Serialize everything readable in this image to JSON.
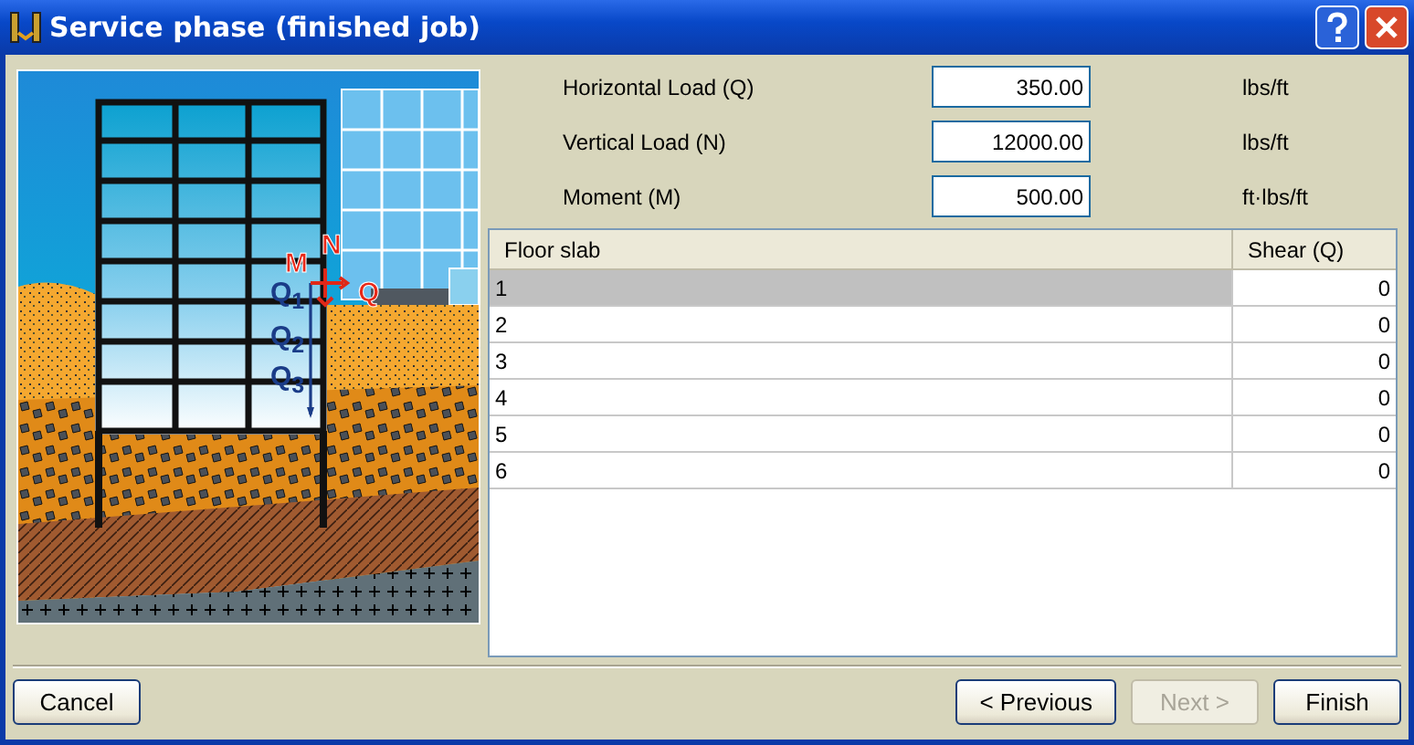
{
  "window": {
    "title": "Service phase (finished job)"
  },
  "diagram": {
    "labels": [
      {
        "text": "M",
        "kind": "load"
      },
      {
        "text": "N",
        "kind": "load"
      },
      {
        "text": "Q",
        "kind": "load"
      },
      {
        "text": "Q$_{1}$",
        "kind": "shear"
      },
      {
        "text": "Q$_{2}$",
        "kind": "shear"
      },
      {
        "text": "Q$_{3}$",
        "kind": "shear"
      }
    ]
  },
  "fields": [
    {
      "label": "Horizontal Load (Q)",
      "value": "350.00",
      "unit": "lbs/ft"
    },
    {
      "label": "Vertical Load (N)",
      "value": "12000.00",
      "unit": "lbs/ft"
    },
    {
      "label": "Moment (M)",
      "value": "500.00",
      "unit": "ft·lbs/ft"
    }
  ],
  "table": {
    "columns": [
      "Floor slab",
      "Shear (Q)"
    ],
    "rows": [
      {
        "cells": [
          "1",
          "0"
        ],
        "selected": true
      },
      {
        "cells": [
          "2",
          "0"
        ],
        "selected": false
      },
      {
        "cells": [
          "3",
          "0"
        ],
        "selected": false
      },
      {
        "cells": [
          "4",
          "0"
        ],
        "selected": false
      },
      {
        "cells": [
          "5",
          "0"
        ],
        "selected": false
      },
      {
        "cells": [
          "6",
          "0"
        ],
        "selected": false
      }
    ]
  },
  "buttons": [
    {
      "label": "Cancel",
      "disabled": false,
      "kind": "left"
    },
    {
      "label": "< Previous",
      "disabled": false,
      "kind": "right"
    },
    {
      "label": "Next >",
      "disabled": true,
      "kind": "right"
    },
    {
      "label": "Finish",
      "disabled": false,
      "kind": "right"
    }
  ]
}
